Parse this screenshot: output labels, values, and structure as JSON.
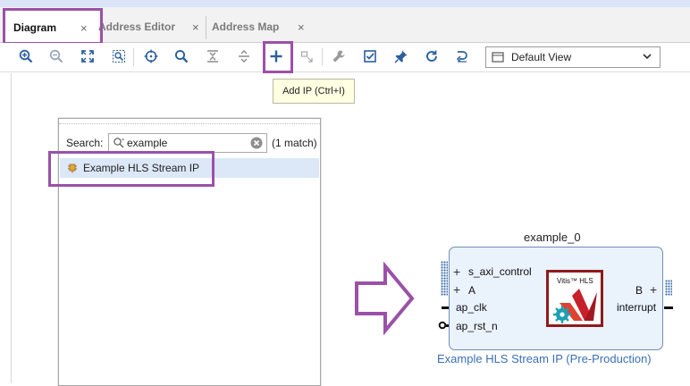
{
  "tabs": [
    {
      "label": "Diagram",
      "active": true
    },
    {
      "label": "Address Editor",
      "active": false
    },
    {
      "label": "Address Map",
      "active": false
    }
  ],
  "tab_close_glyph": "×",
  "toolbar": {
    "icons": [
      "zoom-in-icon",
      "zoom-out-icon",
      "fit-view-icon",
      "zoom-area-icon",
      "target-icon",
      "search-icon",
      "collapse-icon",
      "expand-icon",
      "add-ip-icon",
      "move-icon",
      "wrench-icon",
      "validate-icon",
      "pin-icon",
      "refresh-icon",
      "regenerate-icon"
    ],
    "view_select": "Default View"
  },
  "tooltip": "Add IP (Ctrl+I)",
  "ip_search": {
    "label": "Search:",
    "value": "example",
    "match_count": "(1 match)",
    "results": [
      "Example HLS Stream IP"
    ]
  },
  "ip_block": {
    "instance_name": "example_0",
    "left_pins": [
      "s_axi_control",
      "A",
      "ap_clk",
      "ap_rst_n"
    ],
    "right_pins": [
      "B",
      "interrupt"
    ],
    "logo_text": "Vitis™ HLS",
    "caption": "Example HLS Stream IP (Pre-Production)"
  },
  "colors": {
    "highlight": "#9b51a8",
    "block_fill": "#eaf2fc",
    "block_border": "#6d8fb8",
    "caption": "#3a6fb4",
    "selection": "#dce7f7"
  }
}
